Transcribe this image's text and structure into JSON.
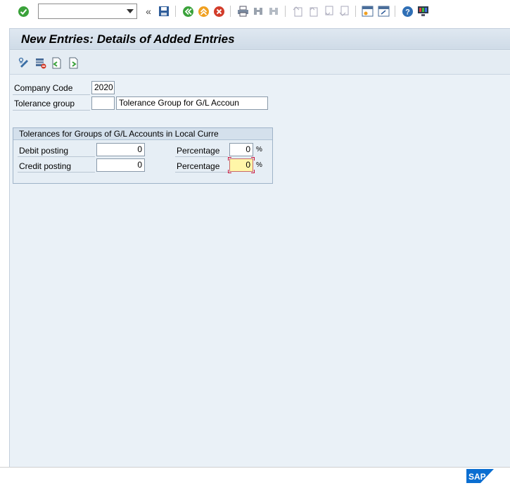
{
  "toolbar": {
    "command_value": "",
    "icons": [
      "enter-icon",
      "back-arrows-icon",
      "save-icon",
      "back-icon",
      "exit-icon",
      "cancel-icon",
      "print-icon",
      "find-icon",
      "find-next-icon",
      "first-page-icon",
      "previous-page-icon",
      "next-page-icon",
      "last-page-icon",
      "create-session-icon",
      "shortcut-icon",
      "help-icon",
      "customize-layout-icon"
    ]
  },
  "title": "New Entries: Details of Added Entries",
  "app_toolbar": {
    "icons": [
      "change-display-icon",
      "delete-icon",
      "previous-entry-icon",
      "next-entry-icon"
    ]
  },
  "header": {
    "company_code_label": "Company Code",
    "company_code_value": "2020",
    "tolerance_group_label": "Tolerance group",
    "tolerance_group_value": "",
    "tolerance_group_text": "Tolerance Group for G/L Accoun"
  },
  "group": {
    "title": "Tolerances for Groups of G/L Accounts in Local Curre",
    "debit_label": "Debit posting",
    "debit_value": "0",
    "debit_pct_label": "Percentage",
    "debit_pct_value": "0",
    "credit_label": "Credit posting",
    "credit_value": "0",
    "credit_pct_label": "Percentage",
    "credit_pct_value": "0",
    "pct_sign": "%"
  },
  "footer": {
    "logo": "SAP"
  },
  "colors": {
    "accent_green": "#3aa23a",
    "accent_orange": "#f0a020",
    "accent_red": "#d23c2a",
    "sap_blue": "#0a6ed1"
  }
}
